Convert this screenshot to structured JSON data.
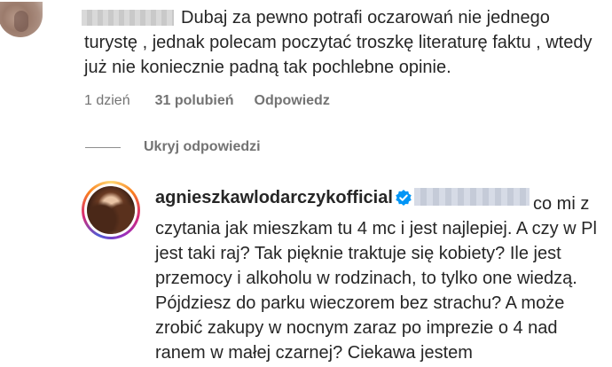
{
  "comment": {
    "text": "Dubaj za pewno potrafi oczarowań nie jednego turystę , jednak polecam poczytać troszkę literaturę faktu , wtedy już nie koniecznie padną tak pochlebne opinie.",
    "time": "1 dzień",
    "likes": "31 polubień",
    "reply_label": "Odpowiedz"
  },
  "replies_toggle": {
    "label": "Ukryj odpowiedzi"
  },
  "reply": {
    "username": "agnieszkawlodarczykofficial",
    "text": "co mi z czytania jak mieszkam tu 4 mc i jest najlepiej. A czy w Pl jest taki raj? Tak pięknie traktuje się kobiety? Ile jest przemocy i alkoholu w rodzinach, to tylko one wiedzą. Pójdziesz do parku wieczorem bez strachu? A może zrobić zakupy w nocnym zaraz po imprezie o 4 nad ranem w małej czarnej? Ciekawa jestem",
    "verified_icon": "verified-badge-icon",
    "ring_colors": [
      "#feda75",
      "#fa7e1e",
      "#d62976",
      "#962fbf",
      "#4f5bd5"
    ],
    "verified_color": "#0095f6"
  }
}
